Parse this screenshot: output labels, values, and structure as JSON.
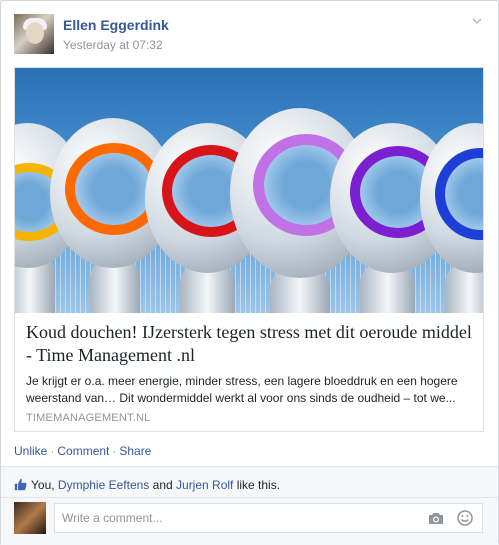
{
  "post": {
    "author": "Ellen Eggerdink",
    "timestamp": "Yesterday at 07:32",
    "options_icon": "chevron-down-icon"
  },
  "link_preview": {
    "image": {
      "description_icon": "shower-heads-image",
      "ring_colors": [
        "#f5b400",
        "#ff6a00",
        "#d7141a",
        "#c071e6",
        "#7b1fd1",
        "#1e3ed8"
      ]
    },
    "title": "Koud douchen! IJzersterk tegen stress met dit oeroude middel - Time Management .nl",
    "description": "Je krijgt er o.a. meer energie, minder stress, een lagere bloeddruk en een hogere weerstand van… Dit wondermiddel werkt al voor ons sinds de oudheid – tot we...",
    "domain": "TIMEMANAGEMENT.NL"
  },
  "actions": {
    "unlike": "Unlike",
    "comment": "Comment",
    "share": "Share",
    "separator": "·"
  },
  "likes": {
    "icon": "thumbs-up-icon",
    "prefix": "You, ",
    "person1": "Dymphie Eeftens",
    "conjunction": " and ",
    "person2": "Jurjen Rolf",
    "suffix": " like this."
  },
  "comment": {
    "placeholder": "Write a comment...",
    "camera_icon": "camera-icon",
    "emoji_icon": "smiley-icon"
  },
  "colors": {
    "link_blue": "#365899",
    "meta_gray": "#90949c",
    "text": "#1d2129"
  }
}
